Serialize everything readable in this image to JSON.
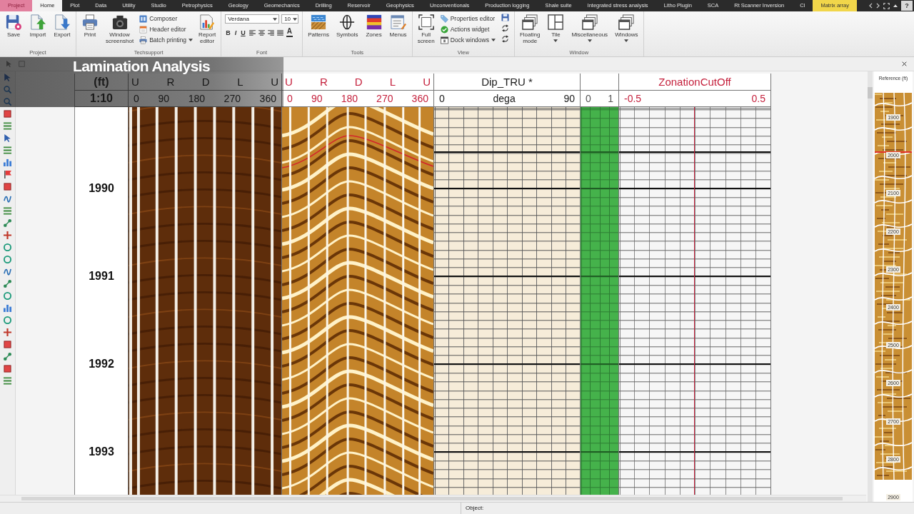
{
  "tabs": [
    {
      "label": "Project",
      "kind": "file",
      "selected": false
    },
    {
      "label": "Home",
      "kind": "normal",
      "selected": true
    },
    {
      "label": "Plot",
      "kind": "normal",
      "selected": false
    },
    {
      "label": "Data",
      "kind": "normal",
      "selected": false
    },
    {
      "label": "Utility",
      "kind": "normal",
      "selected": false
    },
    {
      "label": "Studio",
      "kind": "normal",
      "selected": false
    },
    {
      "label": "Petrophysics",
      "kind": "normal",
      "selected": false
    },
    {
      "label": "Geology",
      "kind": "normal",
      "selected": false
    },
    {
      "label": "Geomechanics",
      "kind": "normal",
      "selected": false
    },
    {
      "label": "Drilling",
      "kind": "normal",
      "selected": false
    },
    {
      "label": "Reservoir",
      "kind": "normal",
      "selected": false
    },
    {
      "label": "Geophysics",
      "kind": "normal",
      "selected": false
    },
    {
      "label": "Unconventionals",
      "kind": "normal",
      "selected": false
    },
    {
      "label": "Production logging",
      "kind": "normal",
      "selected": false
    },
    {
      "label": "Shale suite",
      "kind": "normal",
      "selected": false
    },
    {
      "label": "Integrated stress analysis",
      "kind": "normal",
      "selected": false
    },
    {
      "label": "Litho Plugin",
      "kind": "normal",
      "selected": false
    },
    {
      "label": "SCA",
      "kind": "normal",
      "selected": false
    },
    {
      "label": "Rt Scanner Inversion",
      "kind": "normal",
      "selected": false
    },
    {
      "label": "Cl",
      "kind": "normal",
      "selected": false
    },
    {
      "label": "Matrix array",
      "kind": "contextual",
      "selected": false
    }
  ],
  "help_button": "?",
  "ribbon_groups": [
    {
      "label": "Project",
      "items": [
        {
          "kind": "large",
          "label": "Save",
          "dropdown": false
        },
        {
          "kind": "large",
          "label": "Import",
          "dropdown": false
        },
        {
          "kind": "large",
          "label": "Export",
          "dropdown": false
        }
      ]
    },
    {
      "label": "Techsupport",
      "items": [
        {
          "kind": "large",
          "label": "Print",
          "dropdown": false
        },
        {
          "kind": "large",
          "label": "Window screenshot",
          "dropdown": false
        },
        {
          "kind": "stack",
          "entries": [
            {
              "label": "Composer",
              "dropdown": false
            },
            {
              "label": "Header editor",
              "dropdown": false
            },
            {
              "label": "Batch printing",
              "dropdown": true
            }
          ]
        },
        {
          "kind": "large",
          "label": "Report editor",
          "dropdown": false
        }
      ]
    },
    {
      "label": "Font",
      "items": [
        {
          "kind": "font",
          "font": "Verdana",
          "size": "10",
          "styles": [
            "B",
            "I",
            "U"
          ],
          "color_button": "A"
        }
      ]
    },
    {
      "label": "Tools",
      "items": [
        {
          "kind": "large",
          "label": "Patterns",
          "dropdown": false
        },
        {
          "kind": "large",
          "label": "Symbols",
          "dropdown": false
        },
        {
          "kind": "large",
          "label": "Zones",
          "dropdown": false
        },
        {
          "kind": "large",
          "label": "Menus",
          "dropdown": false
        }
      ]
    },
    {
      "label": "View",
      "items": [
        {
          "kind": "large",
          "label": "Full screen",
          "dropdown": false
        },
        {
          "kind": "stack",
          "entries": [
            {
              "label": "Properties editor",
              "dropdown": false
            },
            {
              "label": "Actions widget",
              "dropdown": false
            },
            {
              "label": "Dock windows",
              "dropdown": true
            }
          ]
        },
        {
          "kind": "icons"
        }
      ]
    },
    {
      "label": "Window",
      "items": [
        {
          "kind": "large",
          "label": "Floating mode",
          "dropdown": false
        },
        {
          "kind": "large",
          "label": "Tile",
          "dropdown": true
        },
        {
          "kind": "large",
          "label": "Miscellaneous",
          "dropdown": true
        },
        {
          "kind": "large",
          "label": "Windows",
          "dropdown": true
        }
      ]
    }
  ],
  "overlay_title": "Lamination Analysis",
  "log_view": {
    "depth_track": {
      "unit": "(ft)",
      "scale": "1:10",
      "depths": [
        "1990",
        "1991",
        "1992",
        "1993"
      ]
    },
    "tracks": [
      {
        "kind": "static",
        "color": "#1a1a1a",
        "title_ticks": [
          "U",
          "R",
          "D",
          "L",
          "U"
        ],
        "scale_ticks": [
          "0",
          "90",
          "180",
          "270",
          "360"
        ]
      },
      {
        "kind": "dynamic",
        "color": "#c41e3a",
        "title_ticks": [
          "U",
          "R",
          "D",
          "L",
          "U"
        ],
        "scale_ticks": [
          "0",
          "90",
          "180",
          "270",
          "360"
        ]
      },
      {
        "kind": "dip",
        "color": "#1a1a1a",
        "title": "Dip_TRU *",
        "scale_ticks": [
          "0",
          "dega",
          "90"
        ]
      },
      {
        "kind": "flag",
        "color": "#555555",
        "scale_ticks": [
          "0",
          "1"
        ]
      },
      {
        "kind": "cutoff",
        "color": "#c41e3a",
        "title": "ZonationCutOff",
        "scale_ticks": [
          "-0.5",
          "0.5"
        ]
      }
    ]
  },
  "reference": {
    "title": "Reference (ft)",
    "depths": [
      "1900",
      "2000",
      "2100",
      "2200",
      "2300",
      "2400",
      "2500",
      "2600",
      "2700",
      "2800",
      "2900"
    ]
  },
  "status_bar": {
    "label": "Object:"
  }
}
